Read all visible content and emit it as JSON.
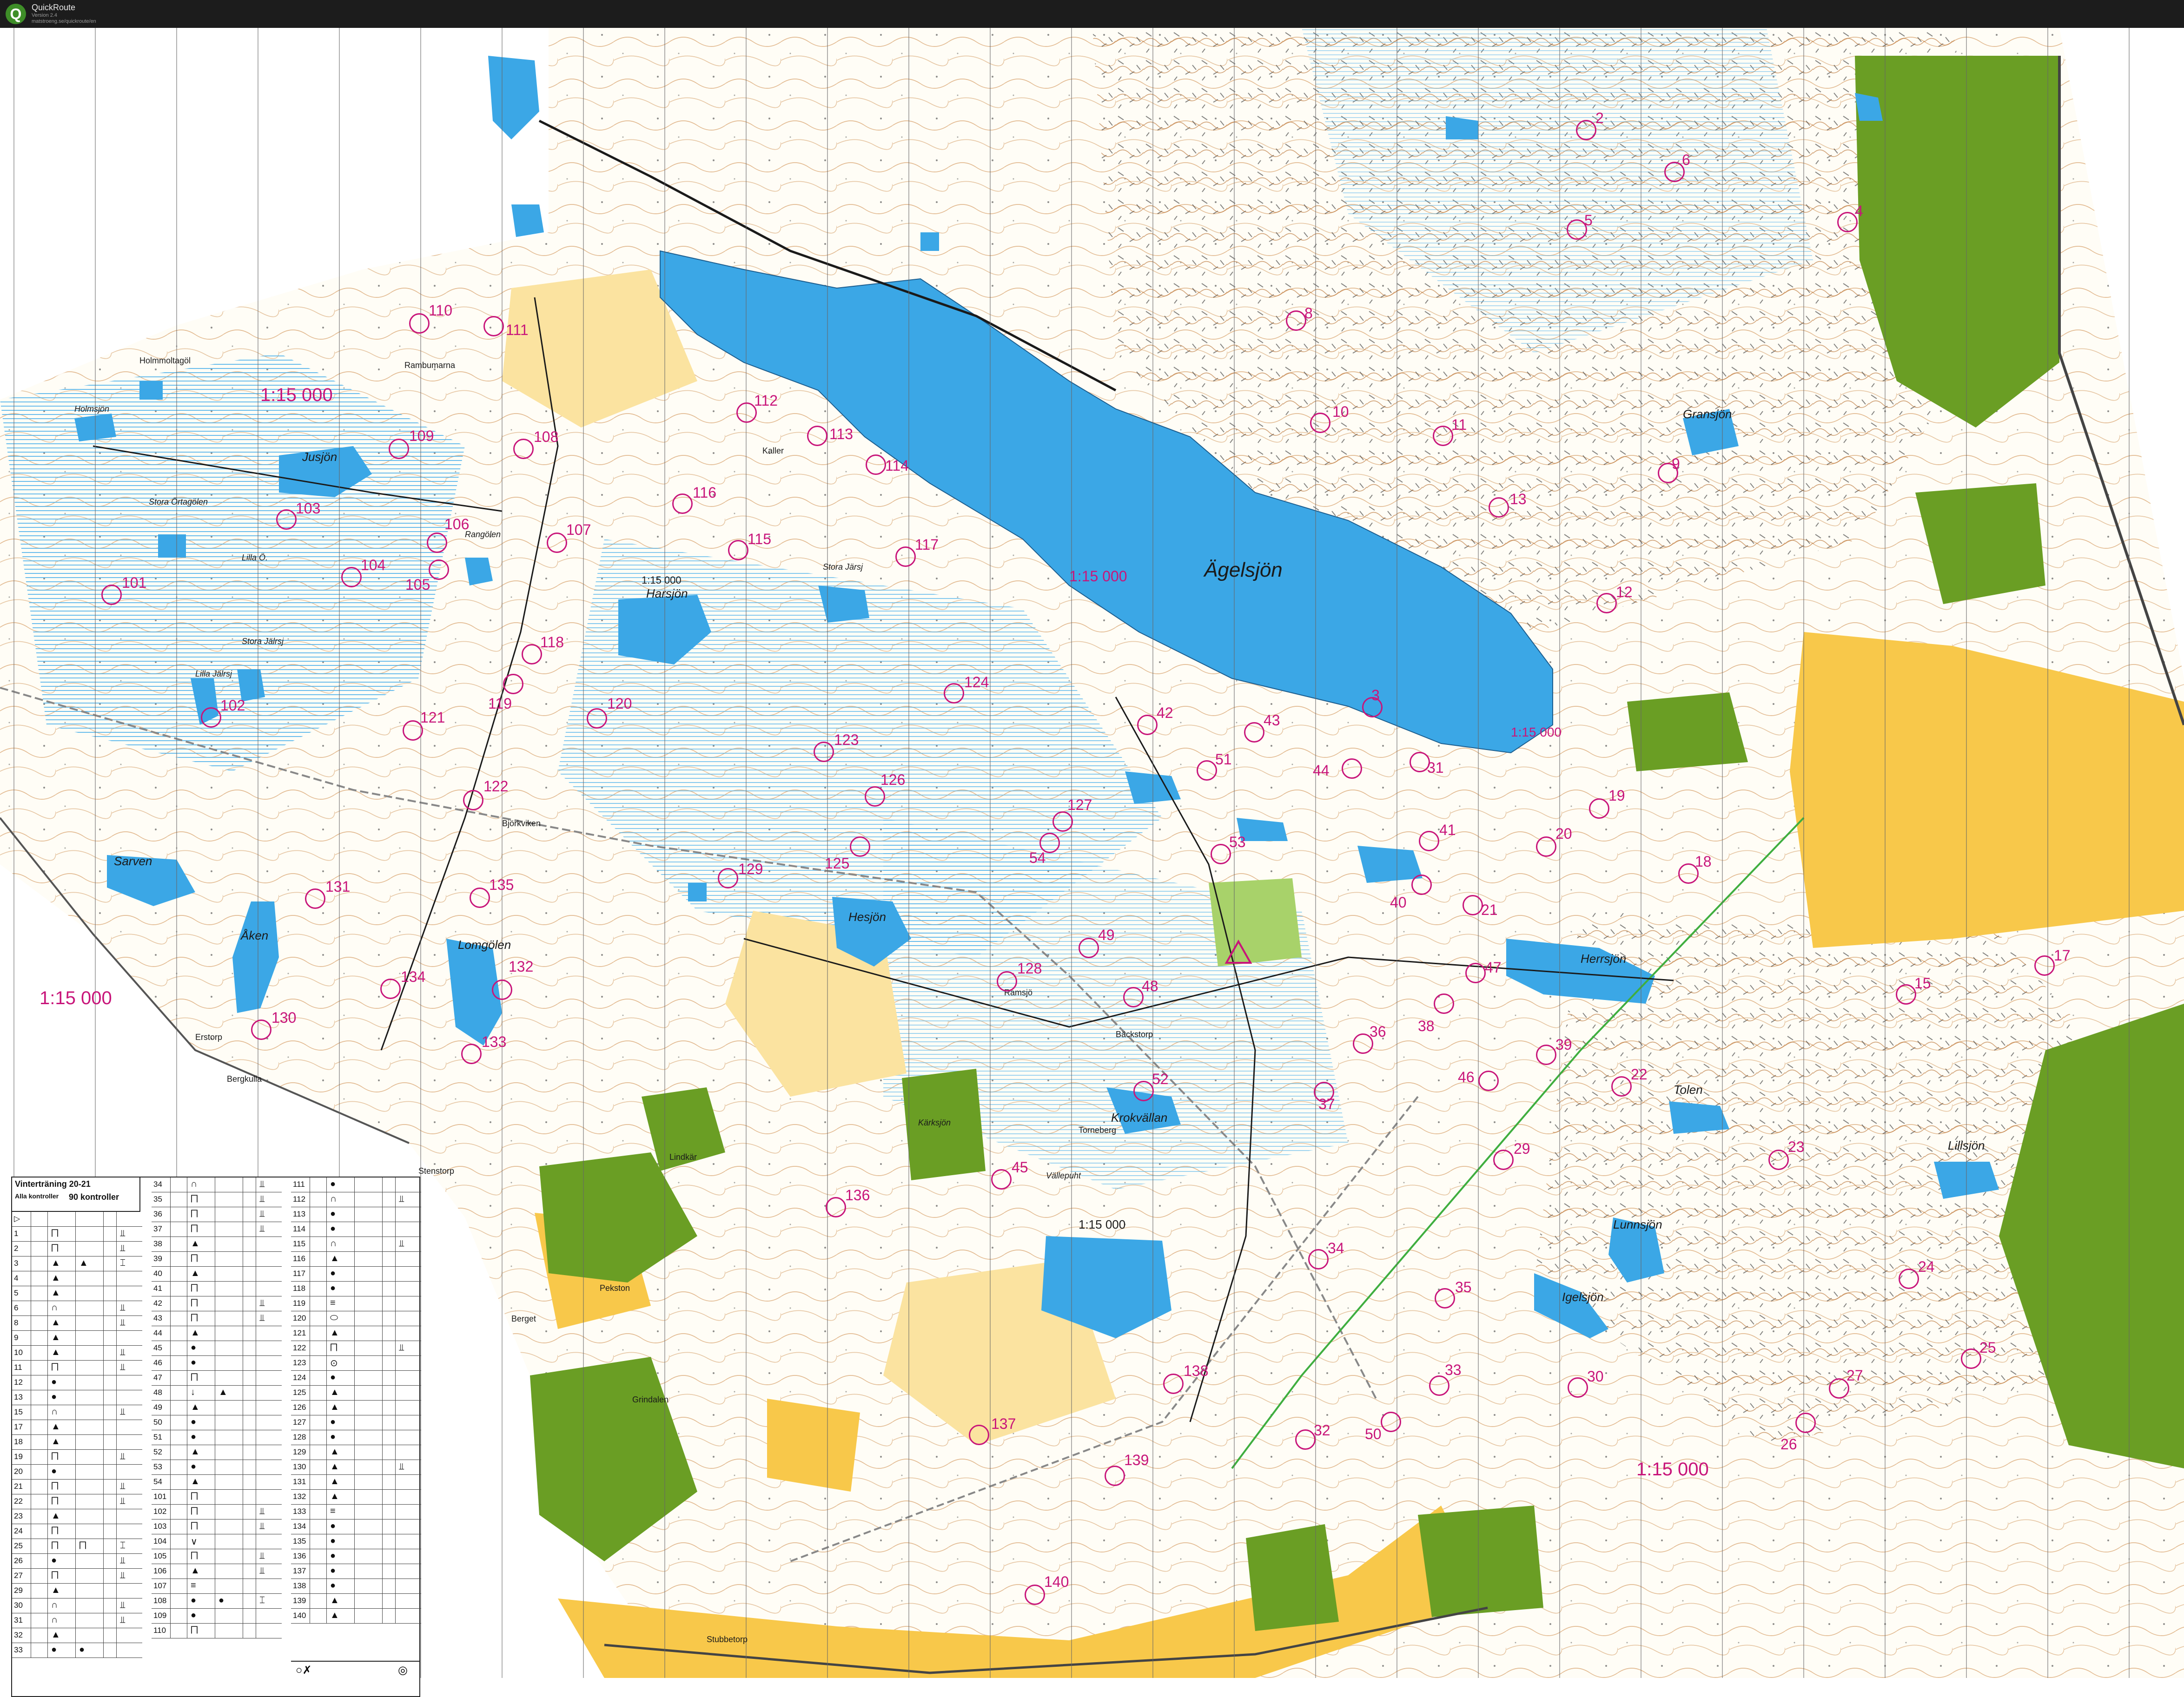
{
  "app": {
    "name": "QuickRoute",
    "version": "Version 2.4",
    "website": "matstroeng.se/quickroute/en"
  },
  "colors": {
    "water": "#3ba7e6",
    "marsh": "#9fd0ef",
    "open_land": "#f8c84a",
    "rough_open": "#fbe3a0",
    "green": "#6a9e24",
    "contour": "#c7762e",
    "overprint": "#c8157a"
  },
  "map": {
    "scale_labels": [
      "1:15 000",
      "1:15 000",
      "1:15 000",
      "1:15 000",
      "1:15 000",
      "1:15 000",
      "1:15 000"
    ],
    "lakes": [
      "Ägelsjön",
      "Jusjön",
      "Harsjön",
      "Hesjön",
      "Sarven",
      "Åken",
      "Lomgölen",
      "Herrsjön",
      "Gransjön",
      "Lillsjön",
      "Igelsjön",
      "Lunnsjön",
      "Tolen",
      "Krokvällan",
      "Kärksjön",
      "Holmsjön",
      "Stora Örtagölen",
      "Lilla Ö.",
      "Stora Jälrsj",
      "Lilla Jälrsj",
      "Stora Järsj",
      "Rangölen",
      "Vällepuht"
    ],
    "places": [
      "Björkviken",
      "Erstorp",
      "Bergkulla",
      "Ramsjö",
      "Bäckstorp",
      "Torneberg",
      "Berget",
      "Stubbetorp",
      "Pekston",
      "Grindalen",
      "Stenstorp",
      "Lindkär",
      "Kaller",
      "Holmmoltagöl",
      "Rambumarna"
    ],
    "controls": [
      {
        "n": "2"
      },
      {
        "n": "3"
      },
      {
        "n": "4"
      },
      {
        "n": "5"
      },
      {
        "n": "6"
      },
      {
        "n": "8"
      },
      {
        "n": "9"
      },
      {
        "n": "10"
      },
      {
        "n": "11"
      },
      {
        "n": "12"
      },
      {
        "n": "13"
      },
      {
        "n": "15"
      },
      {
        "n": "17"
      },
      {
        "n": "18"
      },
      {
        "n": "19"
      },
      {
        "n": "20"
      },
      {
        "n": "21"
      },
      {
        "n": "22"
      },
      {
        "n": "23"
      },
      {
        "n": "24"
      },
      {
        "n": "25"
      },
      {
        "n": "26"
      },
      {
        "n": "27"
      },
      {
        "n": "29"
      },
      {
        "n": "30"
      },
      {
        "n": "31"
      },
      {
        "n": "32"
      },
      {
        "n": "33"
      },
      {
        "n": "34"
      },
      {
        "n": "35"
      },
      {
        "n": "36"
      },
      {
        "n": "37"
      },
      {
        "n": "38"
      },
      {
        "n": "39"
      },
      {
        "n": "40"
      },
      {
        "n": "41"
      },
      {
        "n": "42"
      },
      {
        "n": "43"
      },
      {
        "n": "44"
      },
      {
        "n": "45"
      },
      {
        "n": "46"
      },
      {
        "n": "47"
      },
      {
        "n": "48"
      },
      {
        "n": "49"
      },
      {
        "n": "50"
      },
      {
        "n": "51"
      },
      {
        "n": "52"
      },
      {
        "n": "53"
      },
      {
        "n": "54"
      },
      {
        "n": "101"
      },
      {
        "n": "102"
      },
      {
        "n": "103"
      },
      {
        "n": "104"
      },
      {
        "n": "105"
      },
      {
        "n": "106"
      },
      {
        "n": "107"
      },
      {
        "n": "108"
      },
      {
        "n": "109"
      },
      {
        "n": "110"
      },
      {
        "n": "111"
      },
      {
        "n": "112"
      },
      {
        "n": "113"
      },
      {
        "n": "114"
      },
      {
        "n": "115"
      },
      {
        "n": "116"
      },
      {
        "n": "117"
      },
      {
        "n": "118"
      },
      {
        "n": "119"
      },
      {
        "n": "120"
      },
      {
        "n": "121"
      },
      {
        "n": "122"
      },
      {
        "n": "123"
      },
      {
        "n": "124"
      },
      {
        "n": "125"
      },
      {
        "n": "126"
      },
      {
        "n": "127"
      },
      {
        "n": "128"
      },
      {
        "n": "129"
      },
      {
        "n": "130"
      },
      {
        "n": "131"
      },
      {
        "n": "132"
      },
      {
        "n": "133"
      },
      {
        "n": "134"
      },
      {
        "n": "135"
      },
      {
        "n": "136"
      },
      {
        "n": "137"
      },
      {
        "n": "138"
      },
      {
        "n": "139"
      },
      {
        "n": "140"
      }
    ]
  },
  "description_sheet": {
    "title": "Vinterträning 20-21",
    "subtitle": "Alla kontroller",
    "count": "90 kontroller",
    "col1": [
      {
        "n": "▷",
        "s1": "",
        "s2": "",
        "s3": ""
      },
      {
        "n": "1",
        "s1": "⨅",
        "s2": "",
        "s3": "⫫"
      },
      {
        "n": "2",
        "s1": "⨅",
        "s2": "",
        "s3": "⫫"
      },
      {
        "n": "3",
        "s1": "▲",
        "s2": "▲",
        "s3": "⌶"
      },
      {
        "n": "4",
        "s1": "▲",
        "s2": "",
        "s3": ""
      },
      {
        "n": "5",
        "s1": "▲",
        "s2": "",
        "s3": ""
      },
      {
        "n": "6",
        "s1": "∩",
        "s2": "",
        "s3": "⫫"
      },
      {
        "n": "8",
        "s1": "▲",
        "s2": "",
        "s3": "⫫"
      },
      {
        "n": "9",
        "s1": "▲",
        "s2": "",
        "s3": ""
      },
      {
        "n": "10",
        "s1": "▲",
        "s2": "",
        "s3": "⫫"
      },
      {
        "n": "11",
        "s1": "⨅",
        "s2": "",
        "s3": "⫫"
      },
      {
        "n": "12",
        "s1": "●",
        "s2": "",
        "s3": ""
      },
      {
        "n": "13",
        "s1": "●",
        "s2": "",
        "s3": ""
      },
      {
        "n": "15",
        "s1": "∩",
        "s2": "",
        "s3": "⫫"
      },
      {
        "n": "17",
        "s1": "▲",
        "s2": "",
        "s3": ""
      },
      {
        "n": "18",
        "s1": "▲",
        "s2": "",
        "s3": ""
      },
      {
        "n": "19",
        "s1": "⨅",
        "s2": "",
        "s3": "⫫"
      },
      {
        "n": "20",
        "s1": "●",
        "s2": "",
        "s3": ""
      },
      {
        "n": "21",
        "s1": "⨅",
        "s2": "",
        "s3": "⫫"
      },
      {
        "n": "22",
        "s1": "⨅",
        "s2": "",
        "s3": "⫫"
      },
      {
        "n": "23",
        "s1": "▲",
        "s2": "",
        "s3": ""
      },
      {
        "n": "24",
        "s1": "⨅",
        "s2": "",
        "s3": ""
      },
      {
        "n": "25",
        "s1": "⨅",
        "s2": "⨅",
        "s3": "⌶"
      },
      {
        "n": "26",
        "s1": "●",
        "s2": "",
        "s3": "⫫"
      },
      {
        "n": "27",
        "s1": "⨅",
        "s2": "",
        "s3": "⫫"
      },
      {
        "n": "29",
        "s1": "▲",
        "s2": "",
        "s3": ""
      },
      {
        "n": "30",
        "s1": "∩",
        "s2": "",
        "s3": "⫫"
      },
      {
        "n": "31",
        "s1": "∩",
        "s2": "",
        "s3": "⫫"
      },
      {
        "n": "32",
        "s1": "▲",
        "s2": "",
        "s3": ""
      },
      {
        "n": "33",
        "s1": "●",
        "s2": "●",
        "s3": ""
      }
    ],
    "col2": [
      {
        "n": "34",
        "s1": "∩",
        "s2": "",
        "s3": "⫫"
      },
      {
        "n": "35",
        "s1": "⨅",
        "s2": "",
        "s3": "⫫"
      },
      {
        "n": "36",
        "s1": "⨅",
        "s2": "",
        "s3": "⫫"
      },
      {
        "n": "37",
        "s1": "⨅",
        "s2": "",
        "s3": "⫫"
      },
      {
        "n": "38",
        "s1": "▲",
        "s2": "",
        "s3": ""
      },
      {
        "n": "39",
        "s1": "⨅",
        "s2": "",
        "s3": ""
      },
      {
        "n": "40",
        "s1": "▲",
        "s2": "",
        "s3": ""
      },
      {
        "n": "41",
        "s1": "⨅",
        "s2": "",
        "s3": ""
      },
      {
        "n": "42",
        "s1": "⨅",
        "s2": "",
        "s3": "⫫"
      },
      {
        "n": "43",
        "s1": "⨅",
        "s2": "",
        "s3": "⫫"
      },
      {
        "n": "44",
        "s1": "▲",
        "s2": "",
        "s3": ""
      },
      {
        "n": "45",
        "s1": "●",
        "s2": "",
        "s3": ""
      },
      {
        "n": "46",
        "s1": "●",
        "s2": "",
        "s3": ""
      },
      {
        "n": "47",
        "s1": "⨅",
        "s2": "",
        "s3": ""
      },
      {
        "n": "48",
        "s1": "↓",
        "s2": "▲",
        "s3": ""
      },
      {
        "n": "49",
        "s1": "▲",
        "s2": "",
        "s3": ""
      },
      {
        "n": "50",
        "s1": "●",
        "s2": "",
        "s3": ""
      },
      {
        "n": "51",
        "s1": "●",
        "s2": "",
        "s3": ""
      },
      {
        "n": "52",
        "s1": "▲",
        "s2": "",
        "s3": ""
      },
      {
        "n": "53",
        "s1": "●",
        "s2": "",
        "s3": ""
      },
      {
        "n": "54",
        "s1": "▲",
        "s2": "",
        "s3": ""
      },
      {
        "n": "101",
        "s1": "⨅",
        "s2": "",
        "s3": ""
      },
      {
        "n": "102",
        "s1": "⨅",
        "s2": "",
        "s3": "⫫"
      },
      {
        "n": "103",
        "s1": "⨅",
        "s2": "",
        "s3": "⫫"
      },
      {
        "n": "104",
        "s1": "∨",
        "s2": "",
        "s3": ""
      },
      {
        "n": "105",
        "s1": "⨅",
        "s2": "",
        "s3": "⫫"
      },
      {
        "n": "106",
        "s1": "▲",
        "s2": "",
        "s3": "⫫"
      },
      {
        "n": "107",
        "s1": "≡",
        "s2": "",
        "s3": ""
      },
      {
        "n": "108",
        "s1": "●",
        "s2": "●",
        "s3": "⌶"
      },
      {
        "n": "109",
        "s1": "●",
        "s2": "",
        "s3": ""
      },
      {
        "n": "110",
        "s1": "⨅",
        "s2": "",
        "s3": ""
      }
    ],
    "col3": [
      {
        "n": "111",
        "s1": "●",
        "s2": "",
        "s3": ""
      },
      {
        "n": "112",
        "s1": "∩",
        "s2": "",
        "s3": "⫫"
      },
      {
        "n": "113",
        "s1": "●",
        "s2": "",
        "s3": ""
      },
      {
        "n": "114",
        "s1": "●",
        "s2": "",
        "s3": ""
      },
      {
        "n": "115",
        "s1": "∩",
        "s2": "",
        "s3": "⫫"
      },
      {
        "n": "116",
        "s1": "▲",
        "s2": "",
        "s3": ""
      },
      {
        "n": "117",
        "s1": "●",
        "s2": "",
        "s3": ""
      },
      {
        "n": "118",
        "s1": "●",
        "s2": "",
        "s3": ""
      },
      {
        "n": "119",
        "s1": "≡",
        "s2": "",
        "s3": ""
      },
      {
        "n": "120",
        "s1": "⬭",
        "s2": "",
        "s3": ""
      },
      {
        "n": "121",
        "s1": "▲",
        "s2": "",
        "s3": ""
      },
      {
        "n": "122",
        "s1": "⨅",
        "s2": "",
        "s3": "⫫"
      },
      {
        "n": "123",
        "s1": "⊙",
        "s2": "",
        "s3": ""
      },
      {
        "n": "124",
        "s1": "●",
        "s2": "",
        "s3": ""
      },
      {
        "n": "125",
        "s1": "▲",
        "s2": "",
        "s3": ""
      },
      {
        "n": "126",
        "s1": "▲",
        "s2": "",
        "s3": ""
      },
      {
        "n": "127",
        "s1": "●",
        "s2": "",
        "s3": ""
      },
      {
        "n": "128",
        "s1": "●",
        "s2": "",
        "s3": ""
      },
      {
        "n": "129",
        "s1": "▲",
        "s2": "",
        "s3": ""
      },
      {
        "n": "130",
        "s1": "▲",
        "s2": "",
        "s3": "⫫"
      },
      {
        "n": "131",
        "s1": "▲",
        "s2": "",
        "s3": ""
      },
      {
        "n": "132",
        "s1": "▲",
        "s2": "",
        "s3": ""
      },
      {
        "n": "133",
        "s1": "≡",
        "s2": "",
        "s3": ""
      },
      {
        "n": "134",
        "s1": "●",
        "s2": "",
        "s3": ""
      },
      {
        "n": "135",
        "s1": "●",
        "s2": "",
        "s3": ""
      },
      {
        "n": "136",
        "s1": "●",
        "s2": "",
        "s3": ""
      },
      {
        "n": "137",
        "s1": "●",
        "s2": "",
        "s3": ""
      },
      {
        "n": "138",
        "s1": "●",
        "s2": "",
        "s3": ""
      },
      {
        "n": "139",
        "s1": "▲",
        "s2": "",
        "s3": ""
      },
      {
        "n": "140",
        "s1": "▲",
        "s2": "",
        "s3": ""
      }
    ]
  }
}
